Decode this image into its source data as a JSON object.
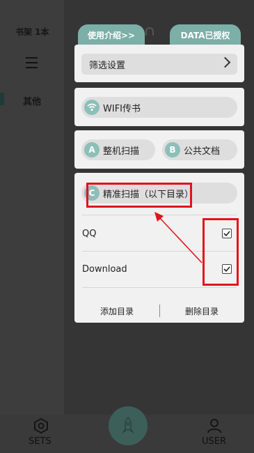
{
  "header": {
    "shelf_title": "书架 1本",
    "tab_intro": "使用介绍>>",
    "tab_data": "DATA已授权"
  },
  "sidebar": {
    "other_label": "其他"
  },
  "popup": {
    "filter_settings": "筛选设置",
    "wifi_transfer": "WIFI传书",
    "full_scan": {
      "badge": "A",
      "label": "整机扫描"
    },
    "public_docs": {
      "badge": "B",
      "label": "公共文档"
    },
    "precise_scan": {
      "badge": "C",
      "label": "精准扫描（以下目录）"
    },
    "directories": [
      {
        "name": "QQ",
        "checked": true
      },
      {
        "name": "Download",
        "checked": true
      }
    ],
    "add_dir": "添加目录",
    "remove_dir": "删除目录"
  },
  "bottom_nav": {
    "sets_label": "SETS",
    "user_label": "USER"
  },
  "icons": {
    "menu": "hamburger-icon",
    "chevron": "chevron-right-icon",
    "wifi": "wifi-icon",
    "sets": "hexagon-gear-icon",
    "user": "user-icon",
    "fab": "rocket-icon"
  },
  "colors": {
    "accent": "#8cbfb8",
    "tab": "#7bafa7",
    "annotation": "#e3131b",
    "fab": "#3d5f5a"
  }
}
